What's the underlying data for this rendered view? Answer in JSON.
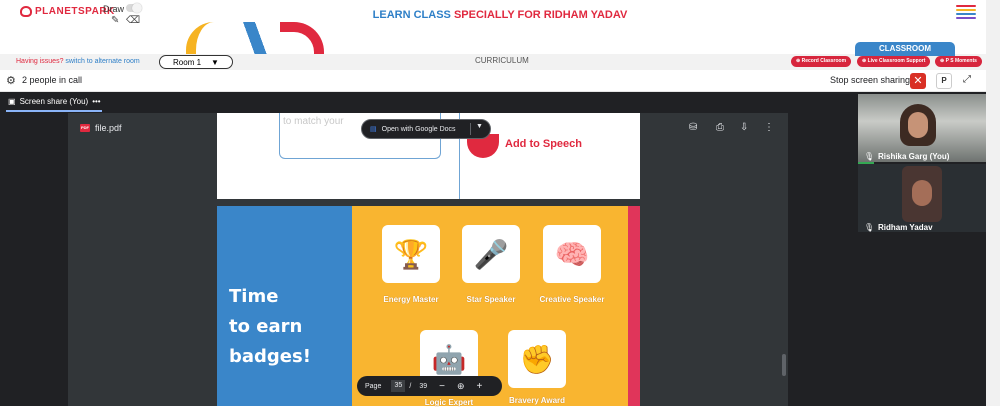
{
  "header": {
    "logo_text": "PLANETSPARK",
    "draw_label": "Draw",
    "title_part1": "LEARN CLASS ",
    "title_part2": "SPECIALLY FOR RIDHAM YADAV",
    "menu_icon": "hamburger-menu-icon",
    "menu_colors": [
      "#e0293f",
      "#f6b322",
      "#3a86c9",
      "#7a4fc8"
    ]
  },
  "strip": {
    "issues_text": "Having issues? ",
    "issues_link": "switch to alternate room",
    "room_label": "Room 1",
    "curriculum_label": "CURRICULUM",
    "classroom_tab": "CLASSROOM",
    "pills": [
      "Record Classroom",
      "Live Classroom Support",
      "P S Moments"
    ]
  },
  "call": {
    "people_count": "2 people in call",
    "stop_sharing": "Stop screen sharing",
    "stop_button": "✕",
    "p_button": "P"
  },
  "share": {
    "tab_label": "Screen share (You)",
    "tab_more": "•••"
  },
  "pdf": {
    "file_name": "file.pdf",
    "open_with": "Open with Google Docs",
    "match_text": "to match your",
    "add_to_speech": "Add to Speech",
    "heading": [
      "Time",
      "to earn",
      "badges!"
    ],
    "badges": [
      {
        "label": "Energy Master",
        "icon": "trophy-icon",
        "glyph": "🏆"
      },
      {
        "label": "Star Speaker",
        "icon": "speaker-icon",
        "glyph": "🎤"
      },
      {
        "label": "Creative Speaker",
        "icon": "brain-icon",
        "glyph": "🧠"
      },
      {
        "label": "Logic Expert",
        "icon": "robot-icon",
        "glyph": "🤖"
      },
      {
        "label": "Bravery Award",
        "icon": "fist-icon",
        "glyph": "✊"
      }
    ],
    "page_label": "Page",
    "page_current": "35",
    "page_sep": "/",
    "page_total": "39"
  },
  "participants": [
    {
      "name": "Rishika Garg (You)"
    },
    {
      "name": "Ridham Yadav"
    }
  ],
  "colors": {
    "brand_red": "#e0293f",
    "brand_blue": "#3a86c9",
    "meet_dark": "#202124"
  }
}
